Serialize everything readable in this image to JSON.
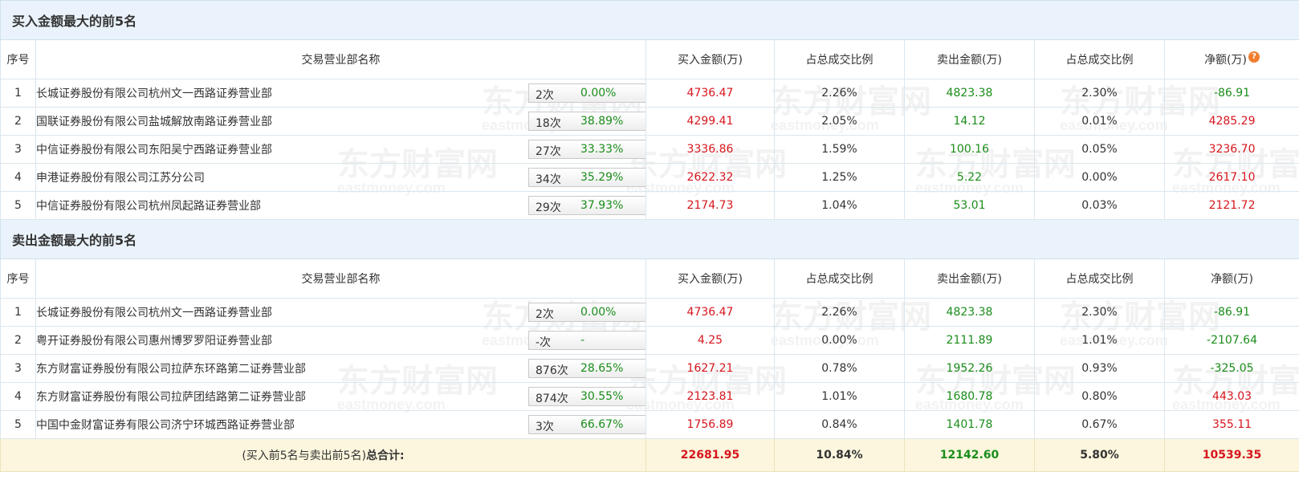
{
  "buy_section": {
    "title": "买入金额最大的前5名",
    "headers": {
      "idx": "序号",
      "name": "交易营业部名称",
      "buy": "买入金额(万)",
      "buy_pct": "占总成交比例",
      "sell": "卖出金额(万)",
      "sell_pct": "占总成交比例",
      "net": "净额(万)"
    },
    "rows": [
      {
        "idx": "1",
        "name": "长城证券股份有限公司杭州文一西路证券营业部",
        "times": "2次",
        "rate": "0.00%",
        "action": "help",
        "buy": "4736.47",
        "buy_pct": "2.26%",
        "sell": "4823.38",
        "sell_pct": "2.30%",
        "net": "-86.91",
        "net_sign": "neg"
      },
      {
        "idx": "2",
        "name": "国联证券股份有限公司盐城解放南路证券营业部",
        "times": "18次",
        "rate": "38.89%",
        "action": "arrow",
        "buy": "4299.41",
        "buy_pct": "2.05%",
        "sell": "14.12",
        "sell_pct": "0.01%",
        "net": "4285.29",
        "net_sign": "pos"
      },
      {
        "idx": "3",
        "name": "中信证券股份有限公司东阳吴宁西路证券营业部",
        "times": "27次",
        "rate": "33.33%",
        "action": "arrow",
        "buy": "3336.86",
        "buy_pct": "1.59%",
        "sell": "100.16",
        "sell_pct": "0.05%",
        "net": "3236.70",
        "net_sign": "pos"
      },
      {
        "idx": "4",
        "name": "申港证券股份有限公司江苏分公司",
        "times": "34次",
        "rate": "35.29%",
        "action": "arrow",
        "buy": "2622.32",
        "buy_pct": "1.25%",
        "sell": "5.22",
        "sell_pct": "0.00%",
        "net": "2617.10",
        "net_sign": "pos"
      },
      {
        "idx": "5",
        "name": "中信证券股份有限公司杭州凤起路证券营业部",
        "times": "29次",
        "rate": "37.93%",
        "action": "arrow",
        "buy": "2174.73",
        "buy_pct": "1.04%",
        "sell": "53.01",
        "sell_pct": "0.03%",
        "net": "2121.72",
        "net_sign": "pos"
      }
    ]
  },
  "sell_section": {
    "title": "卖出金额最大的前5名",
    "headers": {
      "idx": "序号",
      "name": "交易营业部名称",
      "buy": "买入金额(万)",
      "buy_pct": "占总成交比例",
      "sell": "卖出金额(万)",
      "sell_pct": "占总成交比例",
      "net": "净额(万)"
    },
    "rows": [
      {
        "idx": "1",
        "name": "长城证券股份有限公司杭州文一西路证券营业部",
        "times": "2次",
        "rate": "0.00%",
        "action": "help",
        "buy": "4736.47",
        "buy_pct": "2.26%",
        "sell": "4823.38",
        "sell_pct": "2.30%",
        "net": "-86.91",
        "net_sign": "neg"
      },
      {
        "idx": "2",
        "name": "粤开证券股份有限公司惠州博罗罗阳证券营业部",
        "times": "-次",
        "rate": "-",
        "action": "arrow",
        "buy": "4.25",
        "buy_pct": "0.00%",
        "sell": "2111.89",
        "sell_pct": "1.01%",
        "net": "-2107.64",
        "net_sign": "neg"
      },
      {
        "idx": "3",
        "name": "东方财富证券股份有限公司拉萨东环路第二证券营业部",
        "times": "876次",
        "rate": "28.65%",
        "action": "arrow",
        "buy": "1627.21",
        "buy_pct": "0.78%",
        "sell": "1952.26",
        "sell_pct": "0.93%",
        "net": "-325.05",
        "net_sign": "neg"
      },
      {
        "idx": "4",
        "name": "东方财富证券股份有限公司拉萨团结路第二证券营业部",
        "times": "874次",
        "rate": "30.55%",
        "action": "arrow",
        "buy": "2123.81",
        "buy_pct": "1.01%",
        "sell": "1680.78",
        "sell_pct": "0.80%",
        "net": "443.03",
        "net_sign": "pos"
      },
      {
        "idx": "5",
        "name": "中国中金财富证券有限公司济宁环城西路证券营业部",
        "times": "3次",
        "rate": "66.67%",
        "action": "arrow",
        "buy": "1756.89",
        "buy_pct": "0.84%",
        "sell": "1401.78",
        "sell_pct": "0.67%",
        "net": "355.11",
        "net_sign": "pos"
      }
    ]
  },
  "total": {
    "label_prefix": "(买入前5名与卖出前5名)",
    "label_suffix": "总合计:",
    "buy": "22681.95",
    "buy_pct": "10.84%",
    "sell": "12142.60",
    "sell_pct": "5.80%",
    "net": "10539.35"
  },
  "watermark": {
    "cn": "东方财富网",
    "en": "eastmoney.com"
  },
  "icons": {
    "help": "question-icon",
    "arrow": "play-arrow-icon"
  },
  "colors": {
    "red": "#d6161d",
    "green": "#1a8d1a",
    "section_bg": "#eaf3fb",
    "total_bg": "#fbf6dd",
    "help_orange": "#f07e2e",
    "arrow_blue": "#2a5d9a"
  }
}
